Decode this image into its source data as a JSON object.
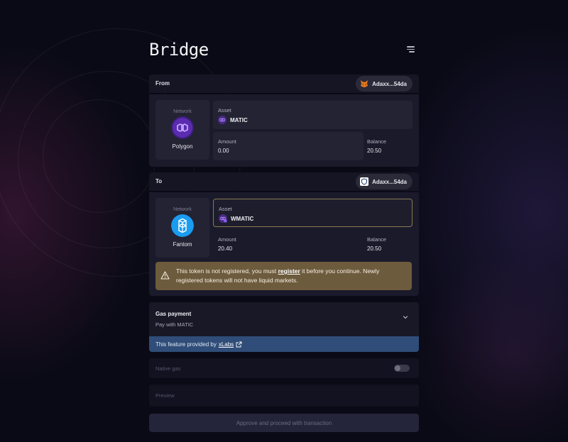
{
  "page": {
    "title": "Bridge"
  },
  "from": {
    "label": "From",
    "wallet": "Adaxx...54da",
    "network_label": "Network",
    "network_name": "Polygon",
    "asset_label": "Asset",
    "asset_value": "MATIC",
    "amount_label": "Amount",
    "amount_value": "0.00",
    "balance_label": "Balance",
    "balance_value": "20.50"
  },
  "to": {
    "label": "To",
    "wallet": "Adaxx...54da",
    "network_label": "Network",
    "network_name": "Fantom",
    "asset_label": "Asset",
    "asset_value": "WMATIC",
    "amount_label": "Amount",
    "amount_value": "20.40",
    "balance_label": "Balance",
    "balance_value": "20.50"
  },
  "warning": {
    "text_before": "This token is not registered, you must ",
    "link": "register",
    "text_after": " it before you continue. Newly registered tokens will not have liquid markets."
  },
  "gas": {
    "title": "Gas payment",
    "subtitle": "Pay with MATIC"
  },
  "xlabs": {
    "text": "This feature provided by",
    "link": "xLabs"
  },
  "native_gas": {
    "label": "Native gas",
    "enabled": false
  },
  "preview": {
    "label": "Preview"
  },
  "approve": {
    "label": "Approve and proceed with transaction"
  },
  "colors": {
    "polygon": "#7b3fe4",
    "fantom": "#1a9cf0",
    "warning_bg": "#6d5b3d",
    "xlabs_bg": "#2f4d78"
  }
}
